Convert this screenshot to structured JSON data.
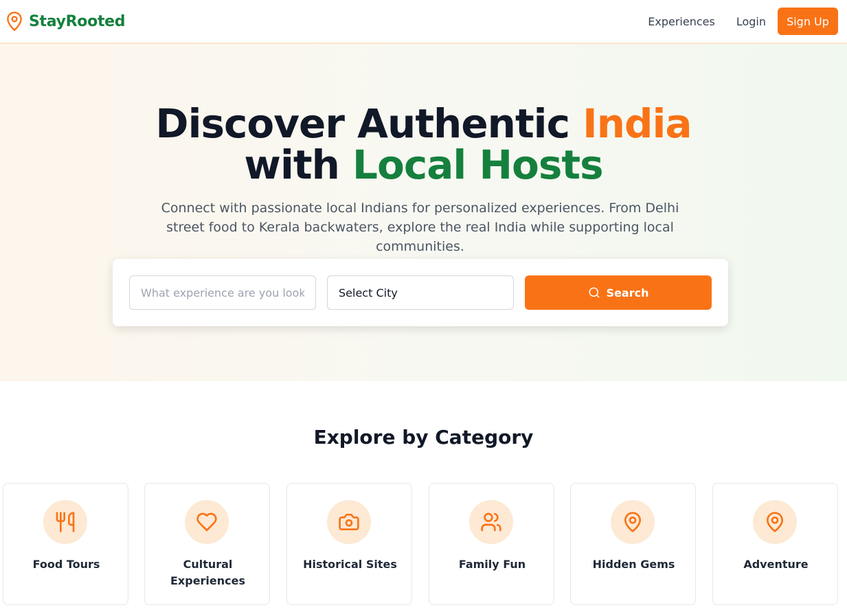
{
  "header": {
    "logo_text": "StayRooted",
    "nav": {
      "experiences": "Experiences",
      "login": "Login",
      "signup": "Sign Up"
    }
  },
  "hero": {
    "title_part1": "Discover Authentic ",
    "title_highlight1": "India",
    "title_part2": "with ",
    "title_highlight2": "Local Hosts",
    "subtitle": "Connect with passionate local Indians for personalized experiences. From Delhi street food to Kerala backwaters, explore the real India while supporting local communities."
  },
  "search": {
    "placeholder": "What experience are you looking for?",
    "city_value": "Select City",
    "button_label": "Search"
  },
  "categories": {
    "title": "Explore by Category",
    "items": [
      {
        "label": "Food Tours",
        "icon": "utensils-icon"
      },
      {
        "label": "Cultural Experiences",
        "icon": "heart-icon"
      },
      {
        "label": "Historical Sites",
        "icon": "camera-icon"
      },
      {
        "label": "Family Fun",
        "icon": "users-icon"
      },
      {
        "label": "Hidden Gems",
        "icon": "map-pin-icon"
      },
      {
        "label": "Adventure",
        "icon": "map-pin-icon"
      }
    ]
  },
  "colors": {
    "brand_orange": "#f97316",
    "brand_green": "#15803d",
    "icon_bg": "#fde9d4"
  }
}
